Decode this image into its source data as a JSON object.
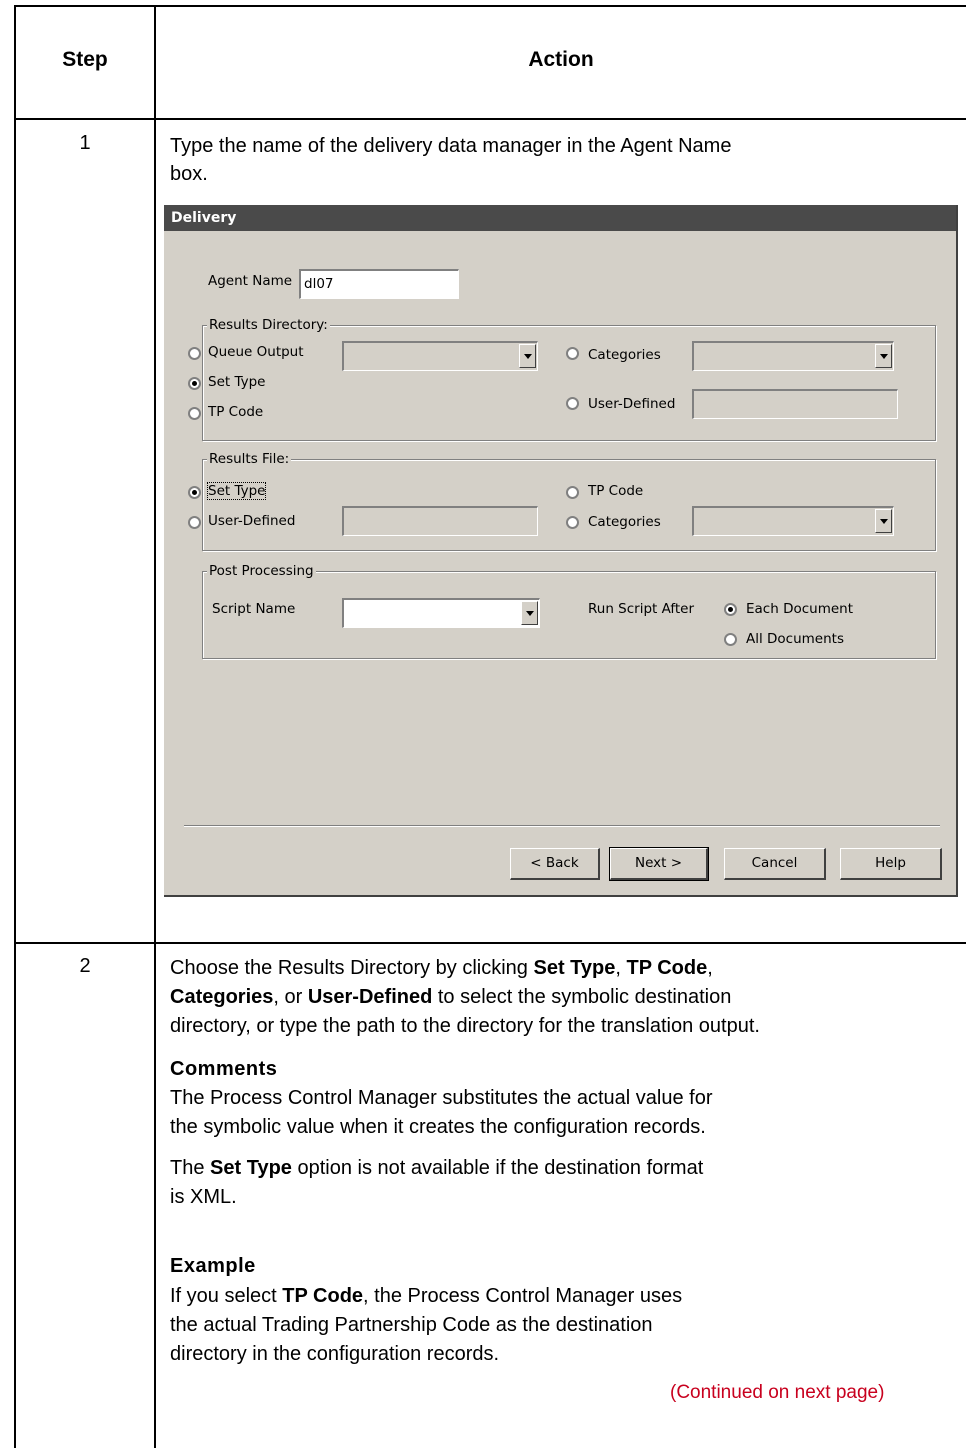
{
  "table": {
    "header_step": "Step",
    "header_action": "Action"
  },
  "step1": {
    "number": "1",
    "text_line1": "Type the name of the delivery data manager in the Agent Name",
    "text_line2": "box."
  },
  "dialog": {
    "title": "Delivery",
    "agent_name_label": "Agent Name",
    "agent_name_value": "dl07",
    "results_directory": {
      "legend": "Results Directory:",
      "queue_output": "Queue Output",
      "set_type": "Set Type",
      "tp_code": "TP Code",
      "categories": "Categories",
      "user_defined": "User-Defined",
      "selected": "Set Type"
    },
    "results_file": {
      "legend": "Results File:",
      "set_type": "Set Type",
      "user_defined": "User-Defined",
      "tp_code": "TP Code",
      "categories": "Categories",
      "selected": "Set Type"
    },
    "post_processing": {
      "legend": "Post Processing",
      "script_name_label": "Script Name",
      "run_script_after_label": "Run Script After",
      "each_document": "Each Document",
      "all_documents": "All Documents",
      "selected": "Each Document"
    },
    "buttons": {
      "back": "< Back",
      "next": "Next >",
      "cancel": "Cancel",
      "help": "Help"
    }
  },
  "step2": {
    "number": "2",
    "line1_pre": "Choose the Results Directory by clicking ",
    "line1_b1": "Set Type",
    "line1_sep": ", ",
    "line1_b2": "TP Code",
    "line1_end": ",",
    "line2_b1": "Categories",
    "line2_mid": ", or ",
    "line2_b2": "User-Defined",
    "line2_end": " to select the symbolic destination",
    "line3": "directory, or type the path to the directory for the translation output.",
    "comments_heading": "Comments",
    "comments_line1": "The Process Control Manager substitutes the actual value for",
    "comments_line2": "the symbolic value when it creates the configuration records.",
    "settype_pre": "The ",
    "settype_b": "Set Type",
    "settype_post": " option is not available if the destination format",
    "settype_line2": "is XML.",
    "example_heading": "Example",
    "example_pre": "If you select ",
    "example_b": "TP Code",
    "example_post": ", the Process Control Manager uses",
    "example_line2": "the actual Trading Partnership Code as the destination",
    "example_line3": "directory in the configuration records.",
    "continued": "(Continued on next page)"
  }
}
